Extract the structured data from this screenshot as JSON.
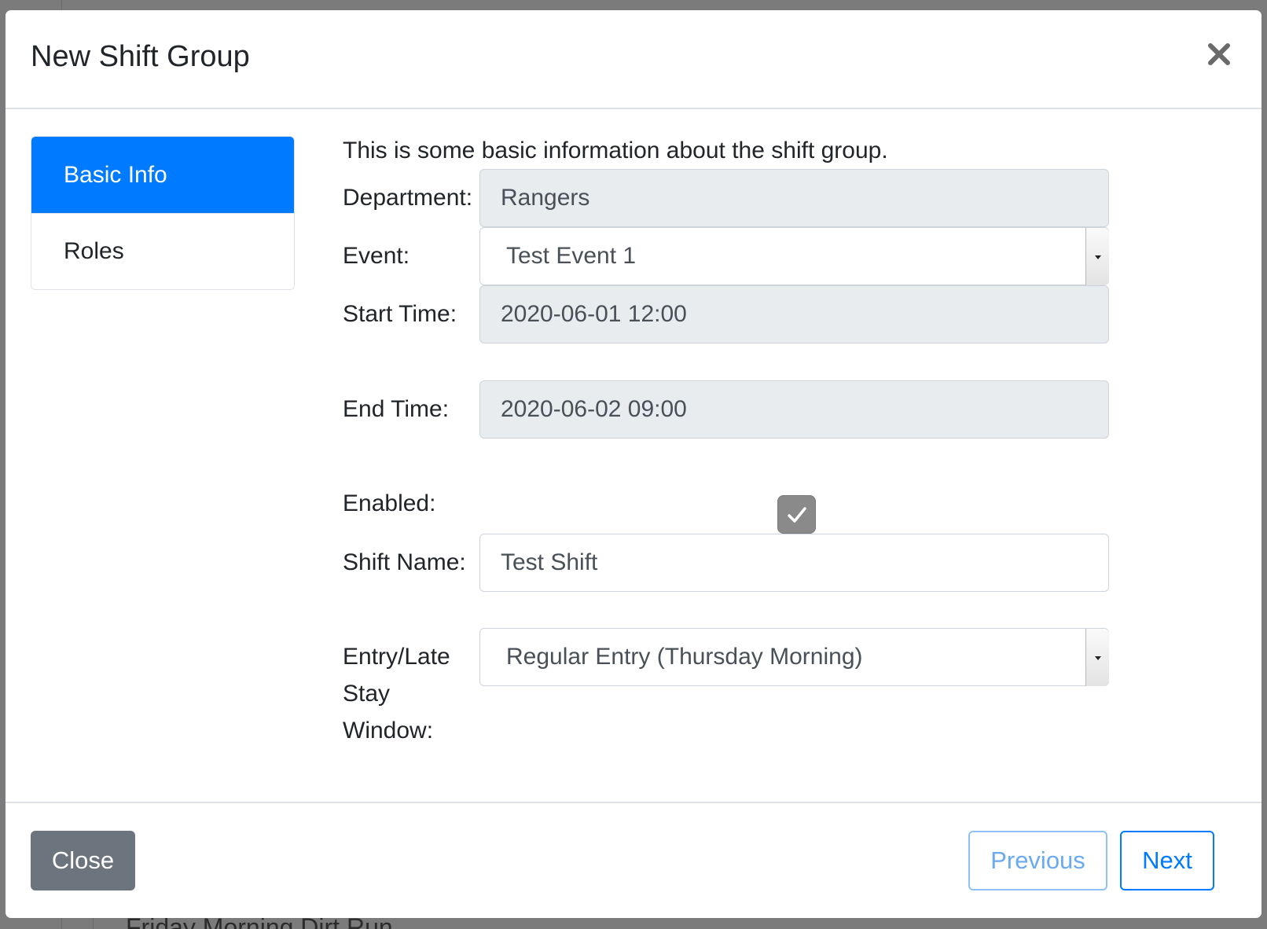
{
  "modal": {
    "title": "New Shift Group",
    "close_icon": "close-icon"
  },
  "nav": {
    "items": [
      {
        "label": "Basic Info",
        "active": true
      },
      {
        "label": "Roles",
        "active": false
      }
    ]
  },
  "form": {
    "intro": "This is some basic information about the shift group.",
    "department": {
      "label": "Department:",
      "value": "Rangers"
    },
    "event": {
      "label": "Event:",
      "value": "Test Event 1"
    },
    "start_time": {
      "label": "Start Time:",
      "value": "2020-06-01 12:00"
    },
    "end_time": {
      "label": "End Time:",
      "value": "2020-06-02 09:00"
    },
    "enabled": {
      "label": "Enabled:",
      "checked": true
    },
    "shift_name": {
      "label": "Shift Name:",
      "value": "Test Shift"
    },
    "entry_window": {
      "label": "Entry/Late Stay Window:",
      "value": "Regular Entry (Thursday Morning)"
    }
  },
  "footer": {
    "close_label": "Close",
    "previous_label": "Previous",
    "next_label": "Next"
  },
  "background": {
    "peek_text": "Friday Morning Dirt Run"
  },
  "colors": {
    "primary": "#007bff",
    "secondary": "#6c757d",
    "readonly_bg": "#e9ecef"
  }
}
